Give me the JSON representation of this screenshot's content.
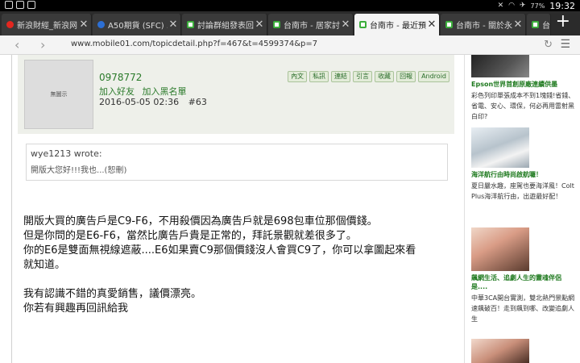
{
  "status_bar": {
    "time": "19:32",
    "battery": "77%"
  },
  "tabs": [
    {
      "title": "新浪財經_新浪网",
      "icon": "sina-icon",
      "active": false
    },
    {
      "title": "A50期貨 (SFC) ...",
      "icon": "globe-icon",
      "active": false
    },
    {
      "title": "討論群組發表回...",
      "icon": "mobile01-icon",
      "active": false
    },
    {
      "title": "台南市 - 居家討...",
      "icon": "mobile01-icon",
      "active": false
    },
    {
      "title": "台南市 - 最近預...",
      "icon": "mobile01-icon",
      "active": true
    },
    {
      "title": "台南市 - 關於永...",
      "icon": "mobile01-icon",
      "active": false
    },
    {
      "title": "台",
      "icon": "mobile01-icon",
      "active": false
    }
  ],
  "address_bar": {
    "url": "www.mobile01.com/topicdetail.php?f=467&t=4599374&p=7"
  },
  "post": {
    "avatar_text": "無圖示",
    "username": "0978772",
    "add_friend": "加入好友",
    "add_blacklist": "加入黑名單",
    "date": "2016-05-05 02:36",
    "floor": "#63",
    "actions": [
      "內文",
      "私訊",
      "連結",
      "引言",
      "收藏",
      "回報",
      "Android"
    ],
    "quote_author": "wye1213 wrote:",
    "quote_text": "開版大您好!!!我也...(恕刪)",
    "body_lines": [
      "開版大買的廣告戶是C9-F6，不用殺價因為廣告戶就是698包車位那個價錢。",
      "但是你問的是E6-F6，當然比廣告戶貴是正常的，拜託景觀就差很多了。",
      "你的E6是雙面無視線遮蔽....E6如果賣C9那個價錢沒人會買C9了，你可以拿圖起來看",
      "就知道。"
    ],
    "body_lines_2": [
      "我有認識不錯的真愛銷售，議價漂亮。",
      "你若有興趣再回訊給我"
    ]
  },
  "sidebar": {
    "items": [
      {
        "title": "Epson世界首創原廠連續供墨",
        "desc": "彩色列印單張成本不到1塊錢!省錢、省電、安心、環保，何必再用雷射黑白印?"
      },
      {
        "title": "海洋航行由時尚啟航囉！",
        "desc": "夏日嚴水趣，座駕也要海洋風！Colt Plus海洋航行由，出遊最好配！"
      },
      {
        "title": "飆網生活、追劇人生的靈魂伴侶是....",
        "desc": "中華3CA開台實測，雙北熱門景點網速飆破百！走到飆到哪、改變追劇人生"
      }
    ]
  }
}
